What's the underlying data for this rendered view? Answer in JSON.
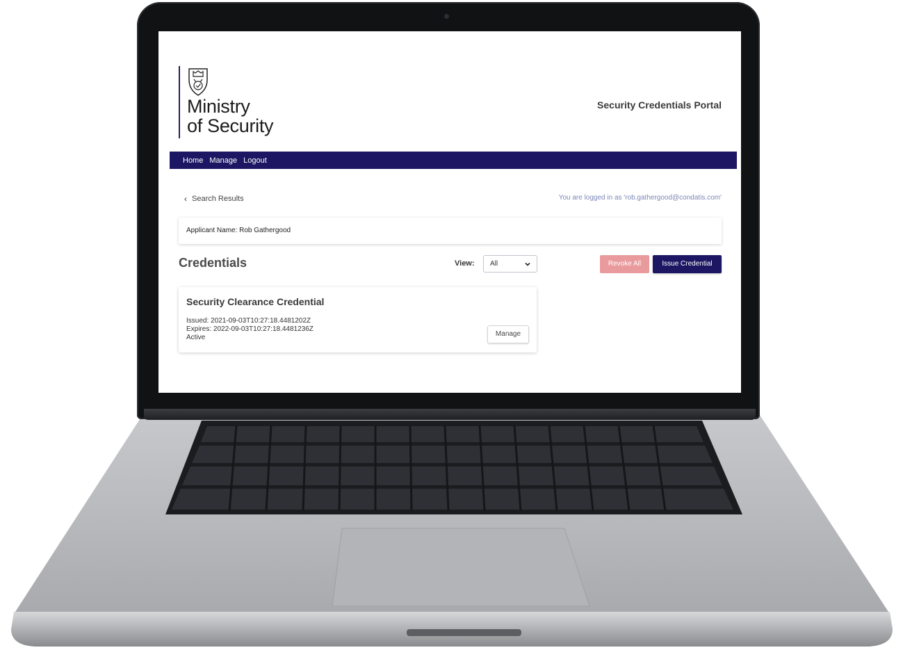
{
  "brand": {
    "crest_icon": "crest-shield-icon",
    "name": "Ministry\nof Security"
  },
  "header": {
    "portal_title": "Security Credentials Portal"
  },
  "nav": {
    "items": [
      {
        "label": "Home"
      },
      {
        "label": "Manage"
      },
      {
        "label": "Logout"
      }
    ]
  },
  "breadcrumb": {
    "back_label": "Search Results",
    "icon": "chevron-left-icon"
  },
  "session": {
    "logged_in_text": "You are logged in as 'rob.gathergood@condatis.com'"
  },
  "applicant": {
    "label": "Applicant Name: Rob Gathergood"
  },
  "credentials": {
    "heading": "Credentials",
    "view_label": "View:",
    "view_selected": "All",
    "revoke_all_label": "Revoke All",
    "issue_label": "Issue Credential",
    "items": [
      {
        "title": "Security Clearance Credential",
        "issued": "Issued: 2021-09-03T10:27:18.4481202Z",
        "expires": "Expires: 2022-09-03T10:27:18.4481236Z",
        "status": "Active",
        "manage_label": "Manage"
      }
    ]
  },
  "colors": {
    "brand_navy": "#1d1763",
    "revoke_pink": "#e99a9c",
    "session_text": "#7b87b6"
  }
}
